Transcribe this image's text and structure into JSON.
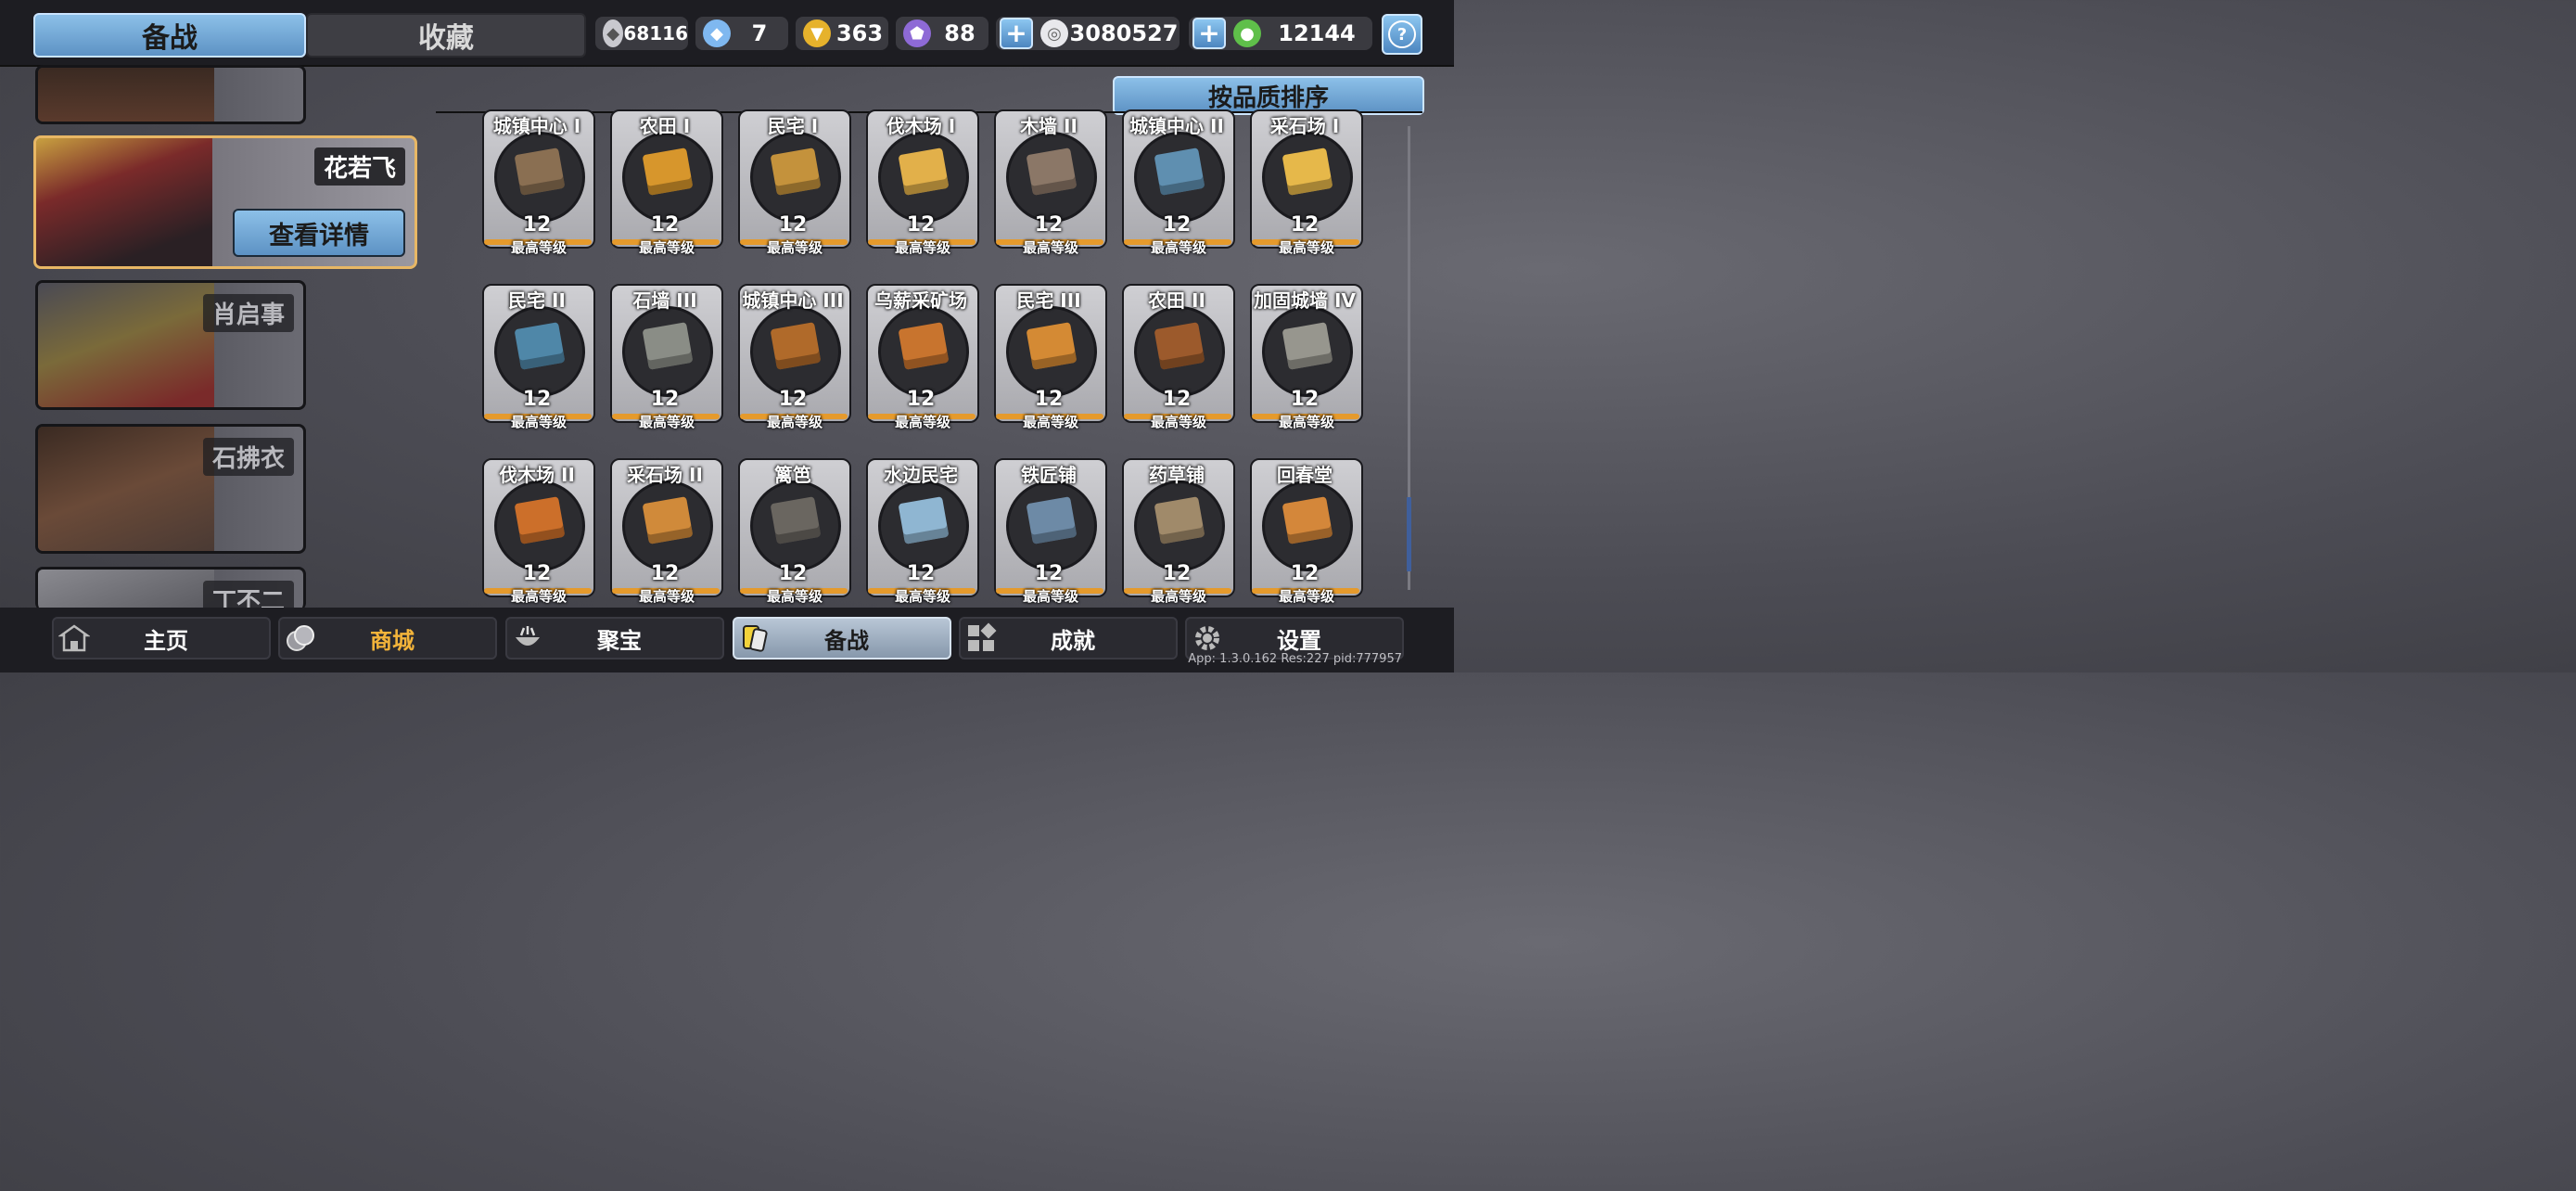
{
  "top_tabs": {
    "active": "备战",
    "inactive": "收藏"
  },
  "resources": [
    {
      "name": "silver-shield",
      "value": "68116",
      "color": "#c9c9cf"
    },
    {
      "name": "blue-crystal",
      "value": "7",
      "color": "#7fb8f0"
    },
    {
      "name": "gold-trophy",
      "value": "363",
      "color": "#e6b22c"
    },
    {
      "name": "purple-shield",
      "value": "88",
      "color": "#8e6ad6"
    },
    {
      "name": "silver-coin",
      "value": "3080527",
      "color": "#e8e8ec"
    },
    {
      "name": "green-jade",
      "value": "12144",
      "color": "#5fbf4a"
    }
  ],
  "heroes": [
    {
      "name": "",
      "partial": true
    },
    {
      "name": "花若飞",
      "selected": true,
      "detail_label": "查看详情"
    },
    {
      "name": "肖启事"
    },
    {
      "name": "石拂衣"
    },
    {
      "name": "丁不二",
      "partial": true
    }
  ],
  "sort_label": "按品质排序",
  "cards": [
    {
      "title": "城镇中心 I",
      "level": "12",
      "color": "#8a6f52"
    },
    {
      "title": "农田 I",
      "level": "12",
      "color": "#d7962c"
    },
    {
      "title": "民宅 I",
      "level": "12",
      "color": "#c4923c"
    },
    {
      "title": "伐木场 I",
      "level": "12",
      "color": "#e2b04a"
    },
    {
      "title": "木墙 II",
      "level": "12",
      "color": "#8b7767"
    },
    {
      "title": "城镇中心 II",
      "level": "12",
      "color": "#5f8fb0"
    },
    {
      "title": "采石场 I",
      "level": "12",
      "color": "#e6b84a"
    },
    {
      "title": "民宅 II",
      "level": "12",
      "color": "#4f87a8"
    },
    {
      "title": "石墙 III",
      "level": "12",
      "color": "#8a8d86"
    },
    {
      "title": "城镇中心 III",
      "level": "12",
      "color": "#b06a2a"
    },
    {
      "title": "乌薪采矿场",
      "level": "12",
      "color": "#c8742e"
    },
    {
      "title": "民宅 III",
      "level": "12",
      "color": "#d48a34"
    },
    {
      "title": "农田 II",
      "level": "12",
      "color": "#9c5a2c"
    },
    {
      "title": "加固城墙 IV",
      "level": "12",
      "color": "#97968e"
    },
    {
      "title": "伐木场 II",
      "level": "12",
      "color": "#cc6f2a"
    },
    {
      "title": "采石场 II",
      "level": "12",
      "color": "#d08a3a"
    },
    {
      "title": "篱笆",
      "level": "12",
      "color": "#6a6660"
    },
    {
      "title": "水边民宅",
      "level": "12",
      "color": "#8fb6d2"
    },
    {
      "title": "铁匠铺",
      "level": "12",
      "color": "#6d8aa6"
    },
    {
      "title": "药草铺",
      "level": "12",
      "color": "#a08a6a"
    },
    {
      "title": "回春堂",
      "level": "12",
      "color": "#d4873a"
    }
  ],
  "card_max_label": "最高等级",
  "nav": [
    {
      "label": "主页",
      "icon": "home-icon"
    },
    {
      "label": "商城",
      "icon": "coins-icon"
    },
    {
      "label": "聚宝",
      "icon": "treasure-bowl-icon"
    },
    {
      "label": "备战",
      "icon": "cards-icon",
      "active": true
    },
    {
      "label": "成就",
      "icon": "grid-icon"
    },
    {
      "label": "设置",
      "icon": "gear-icon"
    }
  ],
  "version_text": "App: 1.3.0.162 Res:227 pid:777957"
}
